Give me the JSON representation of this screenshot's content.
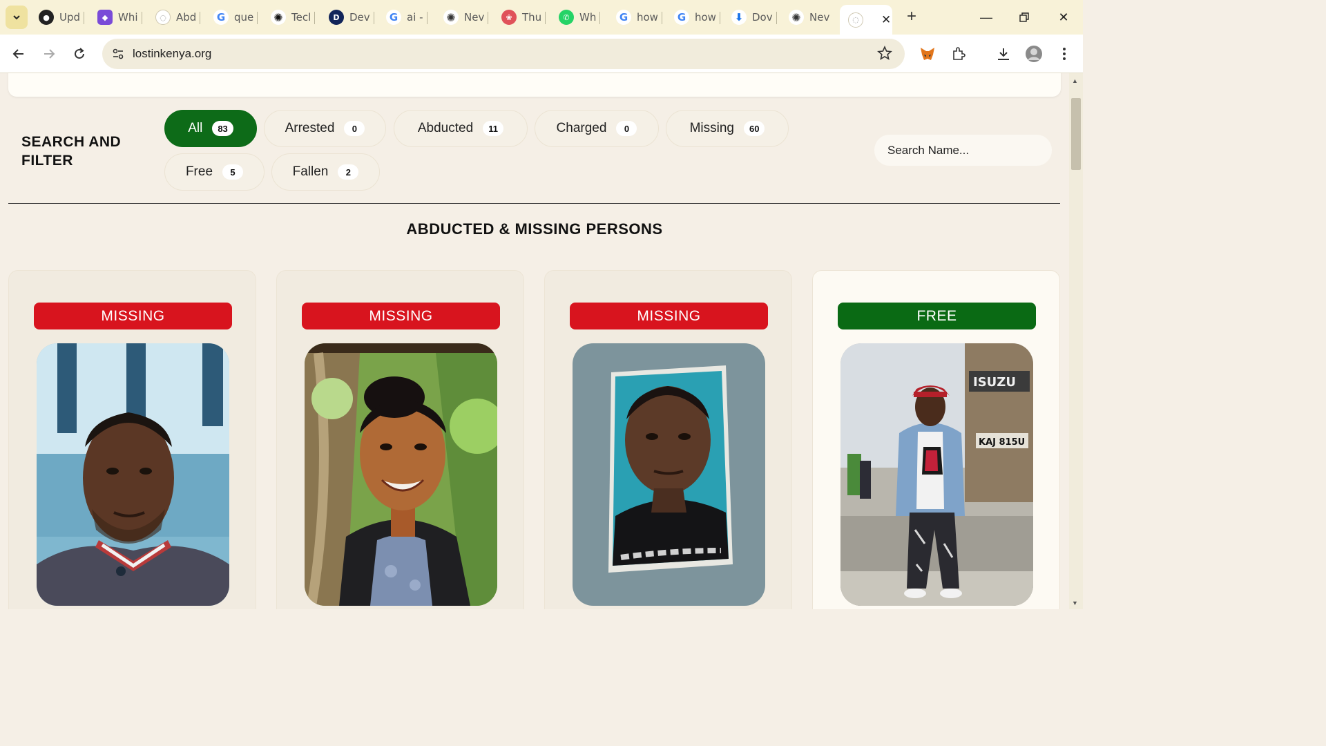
{
  "browser": {
    "tabs": [
      {
        "label": "Upd",
        "icon": "github-icon"
      },
      {
        "label": "Whi",
        "icon": "chat-app-icon"
      },
      {
        "label": "Abd",
        "icon": "globe-icon"
      },
      {
        "label": "que",
        "icon": "google-icon"
      },
      {
        "label": "Tecl",
        "icon": "openai-icon"
      },
      {
        "label": "Dev",
        "icon": "dev-icon"
      },
      {
        "label": "ai -",
        "icon": "google-icon"
      },
      {
        "label": "Nev",
        "icon": "openai-icon"
      },
      {
        "label": "Thu",
        "icon": "brain-icon"
      },
      {
        "label": "Wh",
        "icon": "whatsapp-icon"
      },
      {
        "label": "how",
        "icon": "google-icon"
      },
      {
        "label": "how",
        "icon": "google-icon"
      },
      {
        "label": "Dov",
        "icon": "download-icon"
      },
      {
        "label": "Nev",
        "icon": "openai-icon"
      }
    ],
    "active_tab": {
      "icon": "globe-icon"
    },
    "url": "lostinkenya.org"
  },
  "filter": {
    "title": "SEARCH AND FILTER",
    "chips": [
      {
        "label": "All",
        "count": "83"
      },
      {
        "label": "Arrested",
        "count": "0"
      },
      {
        "label": "Abducted",
        "count": "11"
      },
      {
        "label": "Charged",
        "count": "0"
      },
      {
        "label": "Missing",
        "count": "60"
      },
      {
        "label": "Free",
        "count": "5"
      },
      {
        "label": "Fallen",
        "count": "2"
      }
    ],
    "active_chip": "All",
    "search_placeholder": "Search Name..."
  },
  "section_title": "ABDUCTED & MISSING PERSONS",
  "cards": [
    {
      "status": "MISSING",
      "status_color": "#d8141e"
    },
    {
      "status": "MISSING",
      "status_color": "#d8141e"
    },
    {
      "status": "MISSING",
      "status_color": "#d8141e"
    },
    {
      "status": "FREE",
      "status_color": "#0a6a14"
    }
  ],
  "photo_texts": {
    "truck_brand": "ISUZU",
    "plate": "KAJ 815U"
  },
  "colors": {
    "accent_green": "#0d6b18",
    "alert_red": "#d8141e",
    "page_bg": "#f5efe6"
  }
}
